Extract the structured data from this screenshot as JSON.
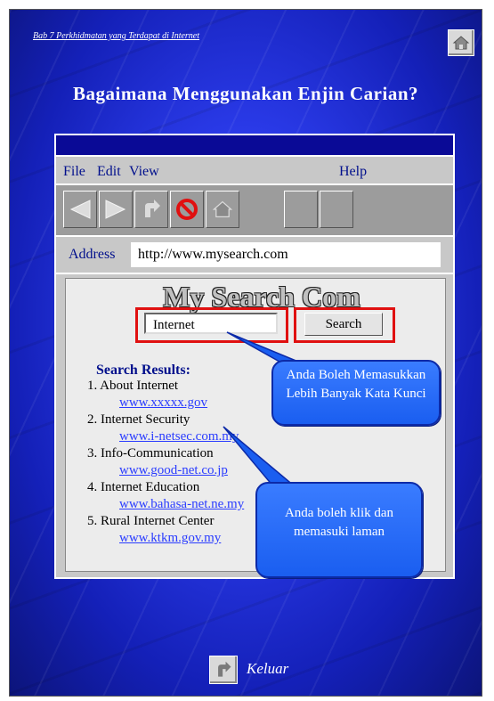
{
  "chapter_link": "Bab 7 Perkhidmatan yang Terdapat di Internet",
  "title": "Bagaimana Menggunakan Enjin Carian?",
  "browser": {
    "menu": [
      "File",
      "Edit",
      "View",
      "Help"
    ],
    "toolbar_icons": [
      "back-arrow-icon",
      "forward-arrow-icon",
      "return-icon",
      "stop-icon",
      "home-icon",
      "blank-icon",
      "blank-icon"
    ],
    "address_label": "Address",
    "address_value": "http://www.mysearch.com",
    "site_logo": "My Search Com",
    "search_value": "Internet",
    "search_button": "Search",
    "results_heading": "Search Results:",
    "results": [
      {
        "label": "1. About Internet",
        "link": "www.xxxxx.gov"
      },
      {
        "label": "2. Internet Security",
        "link": "www.i-netsec.com.my"
      },
      {
        "label": "3. Info-Communication",
        "link": "www.good-net.co.jp"
      },
      {
        "label": "4. Internet Education",
        "link": "www.bahasa-net.ne.my"
      },
      {
        "label": "5. Rural Internet Center",
        "link": "www.ktkm.gov.my"
      }
    ]
  },
  "callouts": {
    "keywords": "Anda Boleh Memasukkan Lebih Banyak Kata Kunci",
    "click": "Anda boleh klik dan memasuki laman"
  },
  "exit_label": "Keluar",
  "colors": {
    "slide_blue": "#2a3ae8",
    "callout_blue": "#1a5ef0",
    "highlight_red": "#e01010",
    "link_blue": "#2a3cff"
  }
}
